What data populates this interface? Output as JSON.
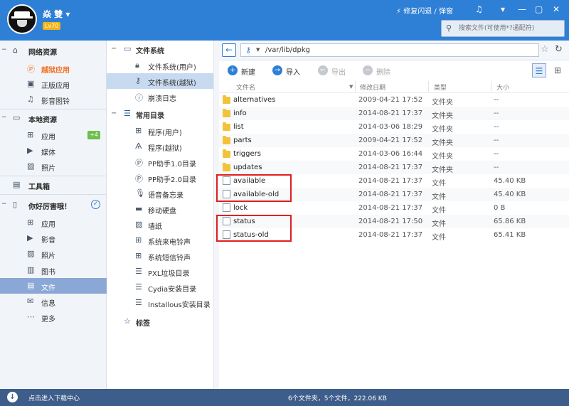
{
  "header": {
    "username": "焱  雙",
    "level": "Lv70",
    "repair_label": "修复闪退 / 弹窗",
    "search_placeholder": "搜索文件(可使用*?通配符)"
  },
  "sidebar": {
    "sections": [
      {
        "label": "网络资源",
        "icon": "home-icon"
      },
      {
        "label": "本地资源",
        "icon": "computer-icon"
      },
      {
        "label": "工具箱",
        "icon": "toolbox-icon"
      },
      {
        "label": "你好厉害哦！",
        "icon": "phone-icon"
      }
    ],
    "items": [
      {
        "label": "越狱应用",
        "icon": "pp-icon"
      },
      {
        "label": "正版应用",
        "icon": "bag-icon"
      },
      {
        "label": "影音图铃",
        "icon": "music-icon"
      },
      {
        "label": "应用",
        "icon": "apps-icon",
        "badge": "+4"
      },
      {
        "label": "媒体",
        "icon": "video-icon"
      },
      {
        "label": "照片",
        "icon": "photo-icon"
      },
      {
        "label": "应用",
        "icon": "apps-icon"
      },
      {
        "label": "影音",
        "icon": "video-icon"
      },
      {
        "label": "照片",
        "icon": "photo-icon"
      },
      {
        "label": "图书",
        "icon": "book-icon"
      },
      {
        "label": "文件",
        "icon": "file-icon"
      },
      {
        "label": "信息",
        "icon": "message-icon"
      },
      {
        "label": "更多",
        "icon": "more-icon"
      }
    ]
  },
  "tree": {
    "groups": [
      {
        "label": "文件系统"
      },
      {
        "label": "常用目录"
      },
      {
        "label": "标签"
      }
    ],
    "items": [
      {
        "label": "文件系统(用户)"
      },
      {
        "label": "文件系统(越狱)"
      },
      {
        "label": "崩溃日志"
      },
      {
        "label": "程序(用户)"
      },
      {
        "label": "程序(越狱)"
      },
      {
        "label": "PP助手1.0目录"
      },
      {
        "label": "PP助手2.0目录"
      },
      {
        "label": "语音备忘录"
      },
      {
        "label": "移动硬盘"
      },
      {
        "label": "墙纸"
      },
      {
        "label": "系统来电铃声"
      },
      {
        "label": "系统短信铃声"
      },
      {
        "label": "PXL垃圾目录"
      },
      {
        "label": "Cydia安装目录"
      },
      {
        "label": "Installous安装目录"
      }
    ]
  },
  "pathbar": {
    "path": "/var/lib/dpkg"
  },
  "toolbar": {
    "new_label": "新建",
    "import_label": "导入",
    "export_label": "导出",
    "delete_label": "删除"
  },
  "table": {
    "columns": [
      "文件名",
      "修改日期",
      "类型",
      "大小"
    ],
    "rows": [
      {
        "name": "alternatives",
        "date": "2009-04-21 17:52",
        "type": "文件夹",
        "size": "--",
        "kind": "folder"
      },
      {
        "name": "info",
        "date": "2014-08-21 17:37",
        "type": "文件夹",
        "size": "--",
        "kind": "folder"
      },
      {
        "name": "list",
        "date": "2014-03-06 18:29",
        "type": "文件夹",
        "size": "--",
        "kind": "folder"
      },
      {
        "name": "parts",
        "date": "2009-04-21 17:52",
        "type": "文件夹",
        "size": "--",
        "kind": "folder"
      },
      {
        "name": "triggers",
        "date": "2014-03-06 16:44",
        "type": "文件夹",
        "size": "--",
        "kind": "folder"
      },
      {
        "name": "updates",
        "date": "2014-08-21 17:37",
        "type": "文件夹",
        "size": "--",
        "kind": "folder"
      },
      {
        "name": "available",
        "date": "2014-08-21 17:37",
        "type": "文件",
        "size": "45.40 KB",
        "kind": "file"
      },
      {
        "name": "available-old",
        "date": "2014-08-21 17:37",
        "type": "文件",
        "size": "45.40 KB",
        "kind": "file"
      },
      {
        "name": "lock",
        "date": "2014-08-21 17:37",
        "type": "文件",
        "size": "0 B",
        "kind": "file"
      },
      {
        "name": "status",
        "date": "2014-08-21 17:50",
        "type": "文件",
        "size": "65.86 KB",
        "kind": "file"
      },
      {
        "name": "status-old",
        "date": "2014-08-21 17:37",
        "type": "文件",
        "size": "65.41 KB",
        "kind": "file"
      }
    ]
  },
  "status": {
    "download_label": "点击进入下载中心",
    "summary": "6个文件夹，5个文件，222.06 KB"
  },
  "colors": {
    "titlebar": "#2e7fd6",
    "accent_orange": "#f37021",
    "highlight_red": "#e02020"
  }
}
